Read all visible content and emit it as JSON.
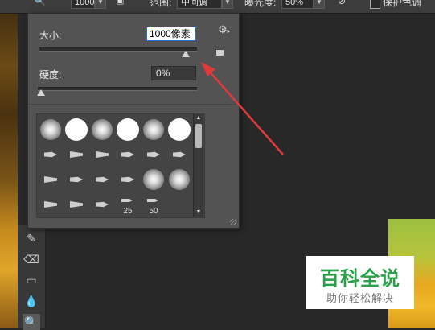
{
  "options_bar": {
    "size_value": "1000",
    "range_label": "范围:",
    "range_value": "中间调",
    "exposure_label": "曝光度:",
    "exposure_value": "50%",
    "protect_tone_label": "保护色调"
  },
  "brush_panel": {
    "size_label": "大小:",
    "size_value": "1000像素",
    "size_slider_fraction": 0.93,
    "hardness_label": "硬度:",
    "hardness_value": "0%",
    "hardness_slider_fraction": 0.0,
    "presets": [
      {
        "kind": "soft"
      },
      {
        "kind": "hard"
      },
      {
        "kind": "soft"
      },
      {
        "kind": "hard"
      },
      {
        "kind": "soft"
      },
      {
        "kind": "hard"
      },
      {
        "kind": "mini"
      },
      {
        "kind": "flat"
      },
      {
        "kind": "flat"
      },
      {
        "kind": "mini"
      },
      {
        "kind": "mini"
      },
      {
        "kind": "mini"
      },
      {
        "kind": "flat"
      },
      {
        "kind": "mini"
      },
      {
        "kind": "mini"
      },
      {
        "kind": "mini"
      },
      {
        "kind": "soft"
      },
      {
        "kind": "soft"
      },
      {
        "kind": "flat"
      },
      {
        "kind": "flat"
      },
      {
        "kind": "mini"
      },
      {
        "kind": "tip",
        "label": "25"
      },
      {
        "kind": "tip",
        "label": "50"
      },
      {
        "kind": "none"
      }
    ]
  },
  "watermark": {
    "title": "百科全说",
    "subtitle": "助你轻松解决",
    "color": "#2aa04a"
  },
  "icons": [
    "gear-icon",
    "new-preset-icon",
    "scroll-up-icon",
    "scroll-down-icon",
    "smudge-tool-icon",
    "eraser-tool-icon",
    "gradient-tool-icon",
    "blur-tool-icon",
    "dodge-tool-icon"
  ]
}
